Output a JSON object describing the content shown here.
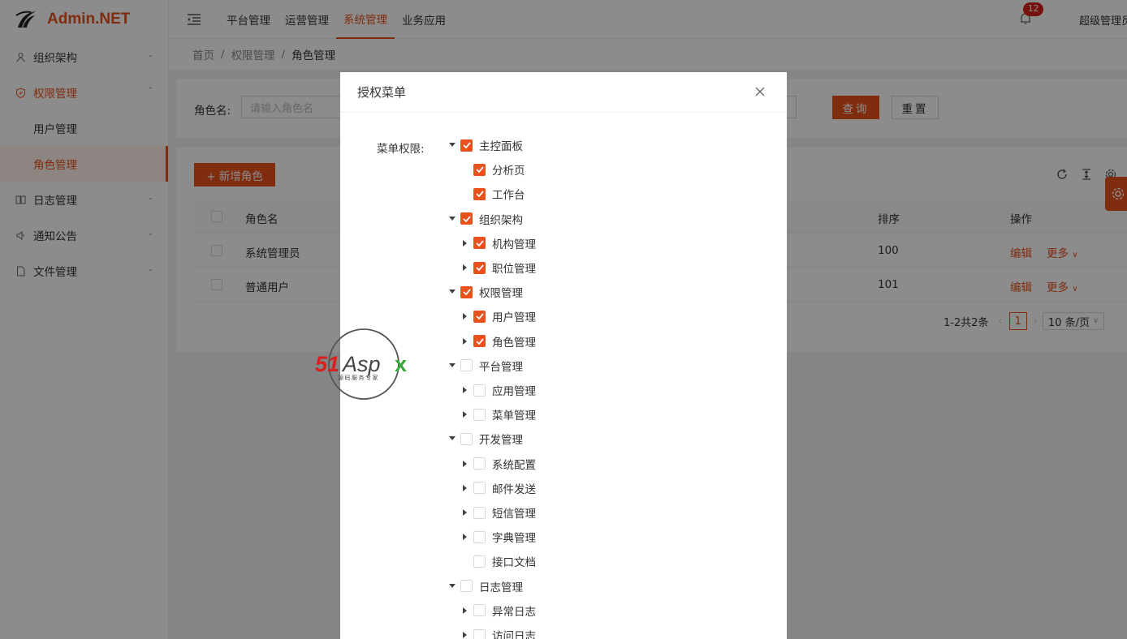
{
  "brand": {
    "name": "Admin.NET"
  },
  "sidebar": {
    "items": [
      {
        "label": "组织架构",
        "icon": "org-icon",
        "expanded": false
      },
      {
        "label": "权限管理",
        "icon": "shield-icon",
        "expanded": true,
        "children": [
          "用户管理",
          "角色管理"
        ],
        "selected_child": "角色管理"
      },
      {
        "label": "日志管理",
        "icon": "log-icon",
        "expanded": false
      },
      {
        "label": "通知公告",
        "icon": "megaphone-icon",
        "expanded": false
      },
      {
        "label": "文件管理",
        "icon": "file-icon",
        "expanded": false
      }
    ]
  },
  "header": {
    "top_menu": [
      "平台管理",
      "运营管理",
      "系统管理",
      "业务应用"
    ],
    "active_top_menu": "系统管理",
    "notification_count": "12",
    "user_name": "超级管理员"
  },
  "breadcrumb": [
    "首页",
    "权限管理",
    "角色管理"
  ],
  "breadcrumb_sep": "/",
  "search": {
    "label": "角色名:",
    "placeholder": "请输入角色名",
    "query_button": "查询",
    "reset_button": "重置"
  },
  "table": {
    "add_button": "+ 新增角色",
    "columns": {
      "name": "角色名",
      "sort": "排序",
      "action": "操作"
    },
    "rows": [
      {
        "name": "系统管理员",
        "sort": "100",
        "edit": "编辑",
        "more": "更多"
      },
      {
        "name": "普通用户",
        "sort": "101",
        "edit": "编辑",
        "more": "更多"
      }
    ],
    "pagination": {
      "total_text": "1-2共2条",
      "current_page": "1",
      "page_size": "10 条/页"
    }
  },
  "modal": {
    "title": "授权菜单",
    "form_label": "菜单权限:",
    "tree": [
      {
        "label": "主控面板",
        "checked": true,
        "level": 0,
        "switcher": "open"
      },
      {
        "label": "分析页",
        "checked": true,
        "level": 1,
        "switcher": "none"
      },
      {
        "label": "工作台",
        "checked": true,
        "level": 1,
        "switcher": "none"
      },
      {
        "label": "组织架构",
        "checked": true,
        "level": 0,
        "switcher": "open"
      },
      {
        "label": "机构管理",
        "checked": true,
        "level": 1,
        "switcher": "closed"
      },
      {
        "label": "职位管理",
        "checked": true,
        "level": 1,
        "switcher": "closed"
      },
      {
        "label": "权限管理",
        "checked": true,
        "level": 0,
        "switcher": "open"
      },
      {
        "label": "用户管理",
        "checked": true,
        "level": 1,
        "switcher": "closed"
      },
      {
        "label": "角色管理",
        "checked": true,
        "level": 1,
        "switcher": "closed"
      },
      {
        "label": "平台管理",
        "checked": false,
        "level": 0,
        "switcher": "open"
      },
      {
        "label": "应用管理",
        "checked": false,
        "level": 1,
        "switcher": "closed"
      },
      {
        "label": "菜单管理",
        "checked": false,
        "level": 1,
        "switcher": "closed"
      },
      {
        "label": "开发管理",
        "checked": false,
        "level": 0,
        "switcher": "open"
      },
      {
        "label": "系统配置",
        "checked": false,
        "level": 1,
        "switcher": "closed"
      },
      {
        "label": "邮件发送",
        "checked": false,
        "level": 1,
        "switcher": "closed"
      },
      {
        "label": "短信管理",
        "checked": false,
        "level": 1,
        "switcher": "closed"
      },
      {
        "label": "字典管理",
        "checked": false,
        "level": 1,
        "switcher": "closed"
      },
      {
        "label": "接口文档",
        "checked": false,
        "level": 1,
        "switcher": "none"
      },
      {
        "label": "日志管理",
        "checked": false,
        "level": 0,
        "switcher": "open"
      },
      {
        "label": "异常日志",
        "checked": false,
        "level": 1,
        "switcher": "closed"
      },
      {
        "label": "访问日志",
        "checked": false,
        "level": 1,
        "switcher": "closed"
      }
    ]
  },
  "watermark": {
    "main": "51Aspx",
    "sub": "源码服务专家"
  },
  "colors": {
    "accent": "#e8501c",
    "badge": "#d9201b",
    "mask": "rgba(0,0,0,0.45)"
  }
}
